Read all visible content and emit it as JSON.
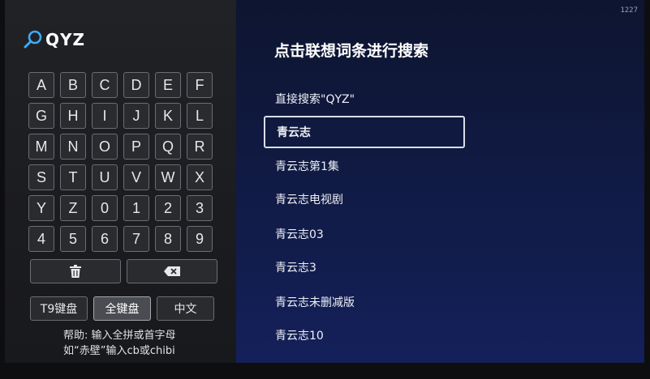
{
  "edge_label": "1227",
  "search": {
    "query": "QYZ"
  },
  "keyboard": {
    "keys": [
      "A",
      "B",
      "C",
      "D",
      "E",
      "F",
      "G",
      "H",
      "I",
      "J",
      "K",
      "L",
      "M",
      "N",
      "O",
      "P",
      "Q",
      "R",
      "S",
      "T",
      "U",
      "V",
      "W",
      "X",
      "Y",
      "Z",
      "0",
      "1",
      "2",
      "3",
      "4",
      "5",
      "6",
      "7",
      "8",
      "9"
    ],
    "clear_icon": "trash-icon",
    "backspace_icon": "backspace-icon"
  },
  "modes": [
    "T9键盘",
    "全键盘",
    "中文"
  ],
  "active_mode_index": 1,
  "help": {
    "line1": "帮助: 输入全拼或首字母",
    "line2": "如“赤壁”输入cb或chibi"
  },
  "panel": {
    "title": "点击联想词条进行搜索"
  },
  "suggestions": [
    "直接搜索\"QYZ\"",
    "青云志",
    "青云志第1集",
    "青云志电视剧",
    "青云志03",
    "青云志3",
    "青云志未删减版",
    "青云志10"
  ],
  "selected_suggestion_index": 1,
  "colors": {
    "selected_border": "#d9deea",
    "panel_blue": "#14205a",
    "left_panel": "#1e1f23"
  }
}
